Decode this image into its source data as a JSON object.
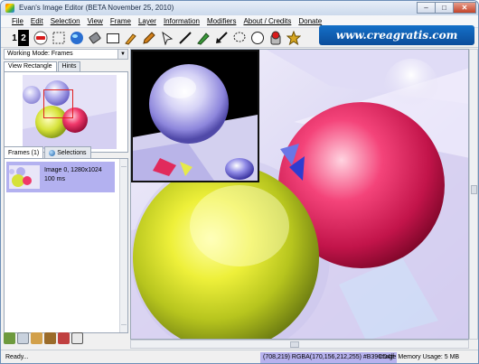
{
  "window": {
    "title": "Evan's Image Editor (BETA November 25, 2010)",
    "controls": [
      "–",
      "□",
      "✕"
    ]
  },
  "menu": [
    "File",
    "Edit",
    "Selection",
    "View",
    "Frame",
    "Layer",
    "Information",
    "Modifiers",
    "About / Credits",
    "Donate"
  ],
  "toolbar": {
    "digits": [
      "1",
      "2"
    ],
    "tools": [
      "record-icon",
      "selection-marquee-icon",
      "globe-icon",
      "eraser-icon",
      "rectangle-icon",
      "brush-icon",
      "pencil-icon",
      "pointer-icon",
      "line-icon",
      "marker-icon",
      "arrow-icon",
      "lasso-icon",
      "circle-icon",
      "bucket-icon",
      "star-icon"
    ]
  },
  "brand": "www.creagratis.com",
  "left_panel": {
    "working_mode": "Working Mode: Frames",
    "tabs": [
      "View Rectangle",
      "Hints"
    ],
    "frames_tab": "Frames (1)",
    "selections_tab": "Selections",
    "frames": [
      {
        "name": "Image 0, 1280x1024",
        "duration": "100 ms"
      }
    ]
  },
  "status": {
    "ready": "Ready...",
    "pixel": "(708,219) RGBA(170,156,212,255) #B39CD4ff",
    "memory": "Image Memory Usage: 5 MB"
  },
  "colors": {
    "selected_frame": "#b3b1f0",
    "status_highlight": "#b7b2ee",
    "brand_bg": "#1470c8",
    "view_rect": "#e02020"
  }
}
